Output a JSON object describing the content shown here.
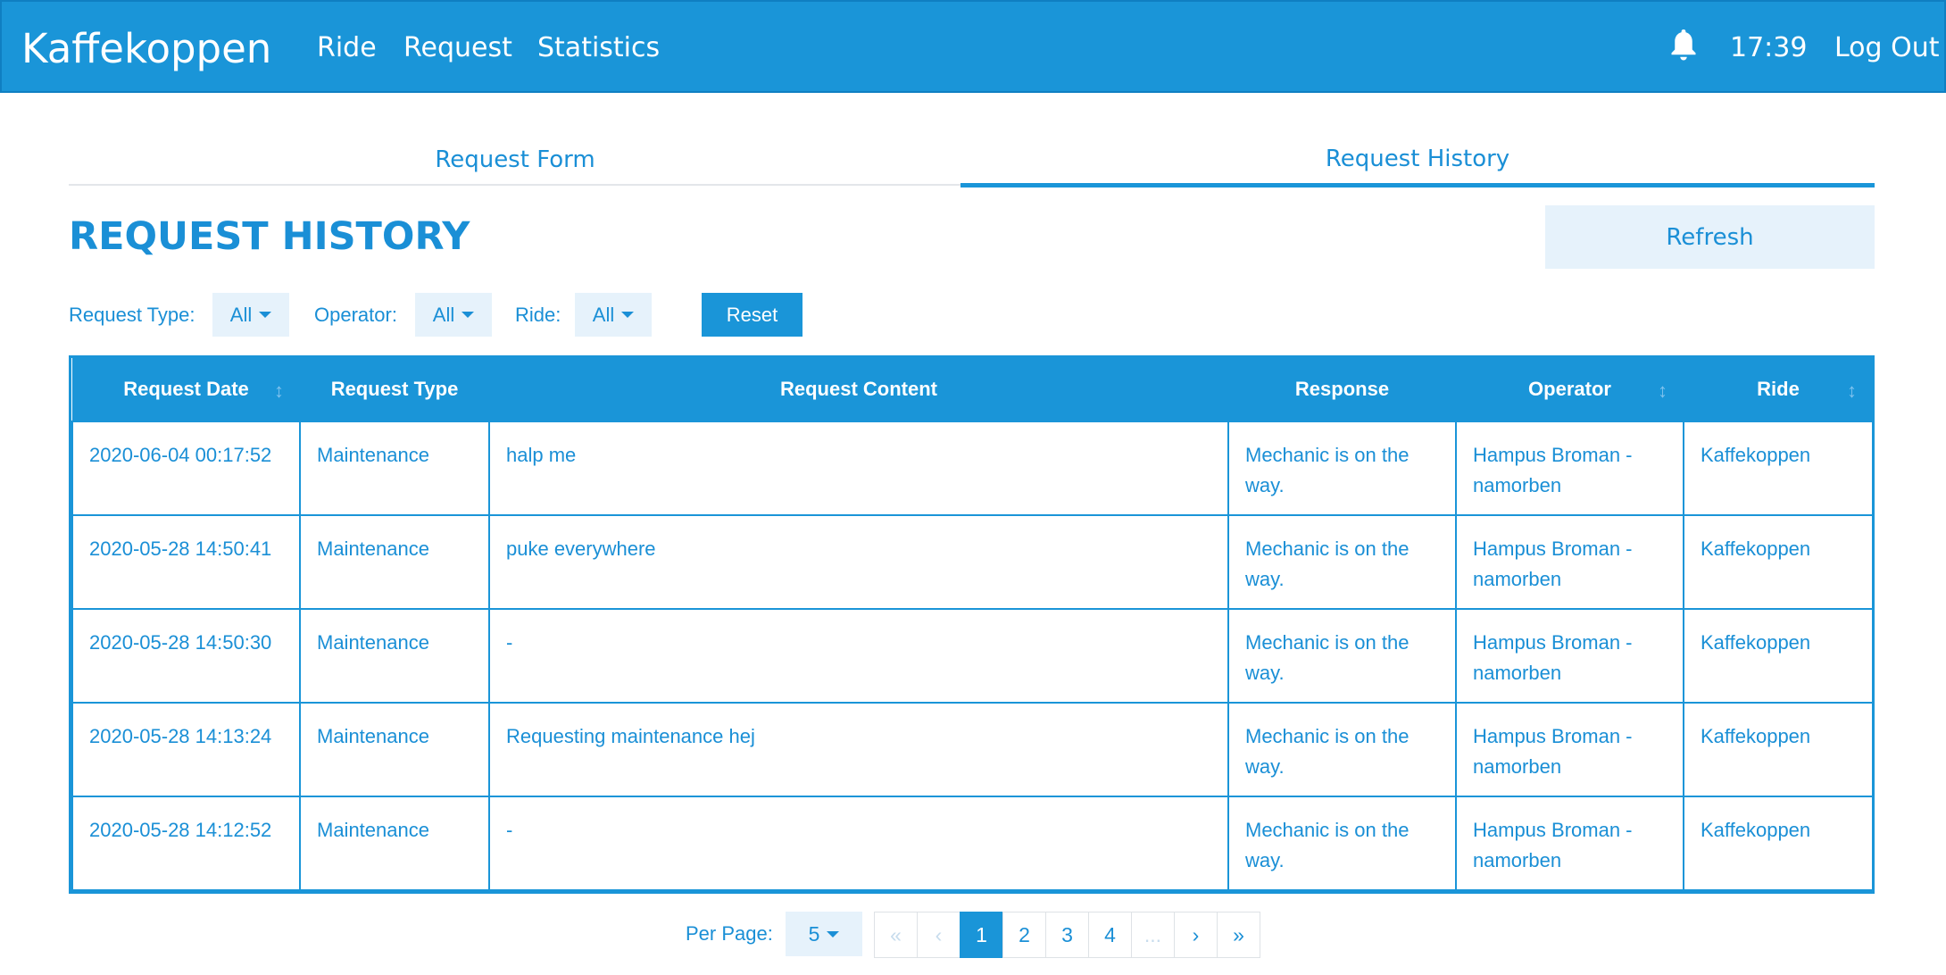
{
  "navbar": {
    "brand": "Kaffekoppen",
    "links": [
      "Ride",
      "Request",
      "Statistics"
    ],
    "time": "17:39",
    "logout": "Log Out"
  },
  "tabs": [
    "Request Form",
    "Request History"
  ],
  "page_title": "REQUEST HISTORY",
  "refresh_label": "Refresh",
  "filters": {
    "request_type_label": "Request Type:",
    "request_type_value": "All",
    "operator_label": "Operator:",
    "operator_value": "All",
    "ride_label": "Ride:",
    "ride_value": "All",
    "reset_label": "Reset"
  },
  "table": {
    "headers": [
      "Request Date",
      "Request Type",
      "Request Content",
      "Response",
      "Operator",
      "Ride"
    ],
    "sort_icon": "↕",
    "rows": [
      [
        "2020-06-04 00:17:52",
        "Maintenance",
        "halp me",
        "Mechanic is on the way.",
        "Hampus Broman - namorben",
        "Kaffekoppen"
      ],
      [
        "2020-05-28 14:50:41",
        "Maintenance",
        "puke everywhere",
        "Mechanic is on the way.",
        "Hampus Broman - namorben",
        "Kaffekoppen"
      ],
      [
        "2020-05-28 14:50:30",
        "Maintenance",
        "-",
        "Mechanic is on the way.",
        "Hampus Broman - namorben",
        "Kaffekoppen"
      ],
      [
        "2020-05-28 14:13:24",
        "Maintenance",
        "Requesting maintenance hej",
        "Mechanic is on the way.",
        "Hampus Broman - namorben",
        "Kaffekoppen"
      ],
      [
        "2020-05-28 14:12:52",
        "Maintenance",
        "-",
        "Mechanic is on the way.",
        "Hampus Broman - namorben",
        "Kaffekoppen"
      ]
    ]
  },
  "pagination": {
    "per_page_label": "Per Page:",
    "per_page_value": "5",
    "first": "«",
    "prev": "‹",
    "pages": [
      "1",
      "2",
      "3",
      "4"
    ],
    "ellipsis": "...",
    "next": "›",
    "last": "»"
  },
  "colors": {
    "primary": "#1a95d8",
    "light": "#e6f2fb"
  }
}
